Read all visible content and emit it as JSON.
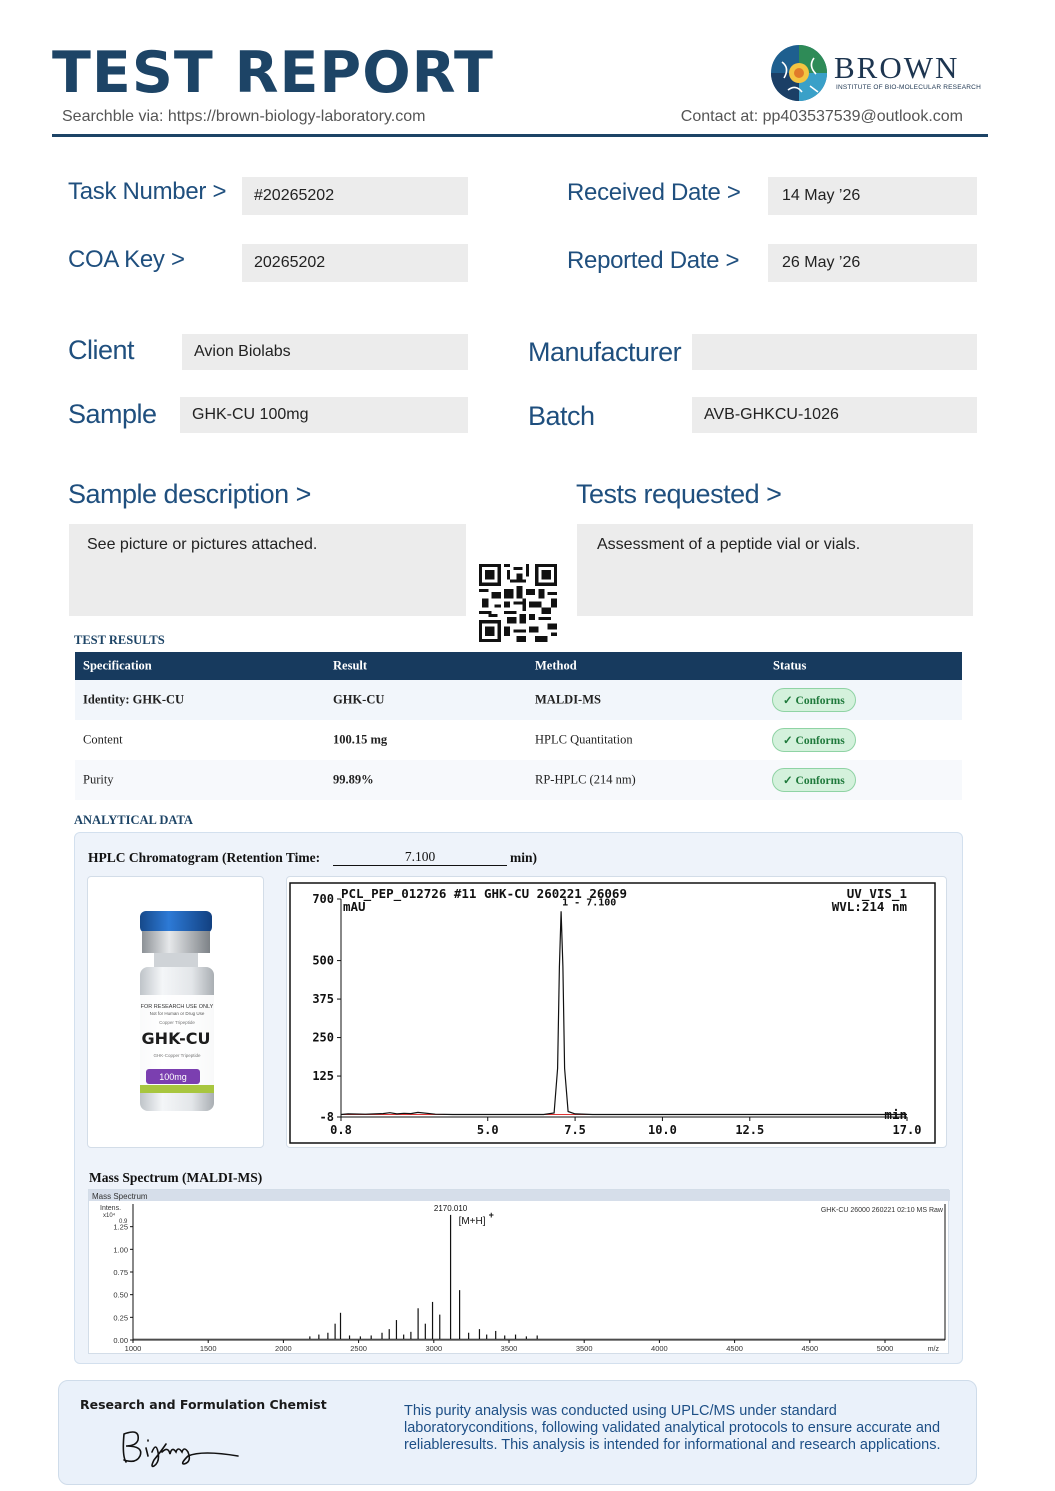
{
  "header": {
    "title": "TEST REPORT",
    "searchable": "Searchble via: https://brown-biology-laboratory.com",
    "contact": "Contact at: pp403537539@outlook.com",
    "logo_name": "BROWN",
    "logo_subtitle": "INSTITUTE OF BIO-MOLECULAR RESEARCH",
    "brand_color": "#1d4466"
  },
  "fields": {
    "task_number_label": "Task Number  >",
    "task_number": "#20265202",
    "coa_key_label": "COA  Key >",
    "coa_key": "20265202",
    "received_date_label": "Received Date  >",
    "received_date": "14 May ’26",
    "reported_date_label": "Reported Date >",
    "reported_date": "26 May ’26",
    "client_label": "Client",
    "client": "Avion Biolabs",
    "manufacturer_label": "Manufacturer",
    "manufacturer": "",
    "sample_label": "Sample",
    "sample": "GHK-CU 100mg",
    "batch_label": "Batch",
    "batch": "AVB-GHKCU-1026"
  },
  "descriptions": {
    "sample_desc_label": "Sample description   >",
    "sample_desc": "See picture or pictures attached.",
    "tests_label": "Tests requested   >",
    "tests": "Assessment of a peptide vial or vials."
  },
  "results": {
    "section_title": "TEST RESULTS",
    "columns": [
      "Specification",
      "Result",
      "Method",
      "Status"
    ],
    "rows": [
      {
        "spec": "Identity:  GHK-CU",
        "result": "GHK-CU",
        "method": "MALDI-MS",
        "status": "✓ Conforms"
      },
      {
        "spec": "Content",
        "result": "100.15 mg",
        "method": "HPLC Quantitation",
        "status": "✓ Conforms"
      },
      {
        "spec": "Purity",
        "result": "99.89%",
        "method": "RP-HPLC (214 nm)",
        "status": "✓ Conforms"
      }
    ]
  },
  "analytical": {
    "section_title": "ANALYTICAL DATA",
    "hplc_title": "HPLC Chromatogram (Retention Time:",
    "retention_time": "7.100",
    "retention_unit": "min)",
    "ms_title": "Mass Spectrum (MALDI-MS)"
  },
  "vial": {
    "line1": "FOR RESEARCH USE ONLY",
    "line2": "Not for Human or Drug Use",
    "line3": "Copper Tripeptide",
    "name": "GHK-CU",
    "line4": "GHK-Copper Tripeptide",
    "dose": "100mg",
    "cap_color": "#1f63b5",
    "band_color": "#7b3fb0",
    "stripe_color": "#a8c63f"
  },
  "chart_data": [
    {
      "type": "line",
      "title": "PCL_PEP_012726 #11 GHK-CU 260221 26069",
      "title_right": "UV_VIS_1",
      "subtitle_right": "WVL:214 nm",
      "ylabel": "mAU",
      "xlabel": "min",
      "peak_label": "1 - 7.100",
      "xlim": [
        0.8,
        17.0
      ],
      "ylim": [
        -8,
        700
      ],
      "x_ticks": [
        "0.8",
        "5.0",
        "7.5",
        "10.0",
        "12.5",
        "17.0"
      ],
      "y_ticks": [
        "700",
        "500",
        "375",
        "250",
        "125",
        "-8"
      ],
      "x": [
        0.8,
        1.0,
        1.5,
        2.0,
        2.2,
        2.4,
        2.6,
        2.8,
        3.0,
        3.5,
        4.0,
        5.0,
        6.0,
        6.6,
        6.9,
        7.0,
        7.05,
        7.1,
        7.15,
        7.2,
        7.3,
        7.5,
        8.0,
        10.0,
        12.5,
        15.0,
        17.0
      ],
      "y": [
        0,
        2,
        1,
        3,
        6,
        2,
        4,
        3,
        7,
        1,
        0,
        0,
        0,
        0,
        5,
        150,
        480,
        660,
        480,
        150,
        10,
        2,
        0,
        0,
        0,
        0,
        0
      ]
    },
    {
      "type": "bar",
      "header": "Mass Spectrum",
      "title_right": "GHK-CU 26000 260221 02:10 MS Raw",
      "ylabel": "Intens.",
      "y_multiplier": "x10⁴",
      "y_top": "0.9",
      "peak_label": "2170.010",
      "ion_label": "[M+H]",
      "ion_sup": "+",
      "xlabel": "m/z",
      "xlim": [
        1000,
        5500
      ],
      "ylim": [
        0,
        1.5
      ],
      "x_ticks": [
        "1000",
        "1500",
        "2000",
        "2500",
        "3000",
        "3500",
        "3500",
        "4000",
        "4500",
        "4500",
        "5000"
      ],
      "y_ticks": [
        "1.25",
        "1.00",
        "0.75",
        "0.50",
        "0.25",
        "0.00"
      ],
      "x": [
        1980,
        2030,
        2080,
        2120,
        2150,
        2200,
        2260,
        2320,
        2380,
        2420,
        2460,
        2500,
        2540,
        2580,
        2620,
        2660,
        2700,
        2760,
        2810,
        2860,
        2920,
        2960,
        3010,
        3060,
        3120,
        3180,
        3240
      ],
      "y": [
        0.04,
        0.06,
        0.08,
        0.18,
        0.3,
        0.05,
        0.04,
        0.05,
        0.08,
        0.12,
        0.22,
        0.06,
        0.09,
        0.35,
        0.18,
        0.42,
        0.28,
        1.38,
        0.55,
        0.08,
        0.12,
        0.06,
        0.1,
        0.05,
        0.06,
        0.04,
        0.05
      ]
    }
  ]
}
